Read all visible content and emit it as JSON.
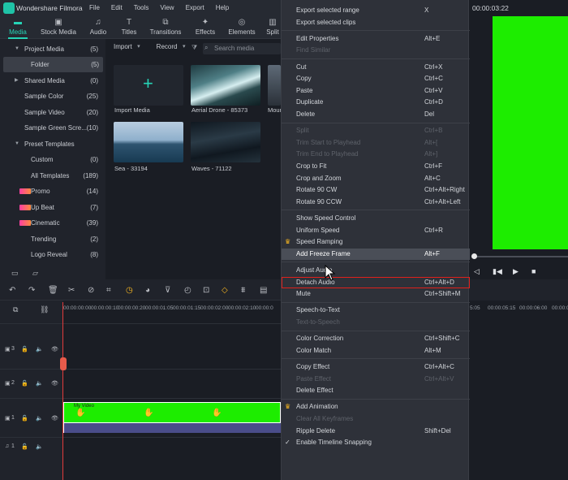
{
  "app": {
    "title": "Wondershare Filmora",
    "menu": [
      "File",
      "Edit",
      "Tools",
      "View",
      "Export",
      "Help"
    ]
  },
  "tabs": [
    {
      "label": "Media",
      "active": true,
      "icon": "folder-icon"
    },
    {
      "label": "Stock Media",
      "active": false,
      "icon": "stock-icon"
    },
    {
      "label": "Audio",
      "active": false,
      "icon": "music-icon"
    },
    {
      "label": "Titles",
      "active": false,
      "icon": "text-icon"
    },
    {
      "label": "Transitions",
      "active": false,
      "icon": "transition-icon"
    },
    {
      "label": "Effects",
      "active": false,
      "icon": "effects-icon"
    },
    {
      "label": "Elements",
      "active": false,
      "icon": "elements-icon"
    },
    {
      "label": "Split",
      "active": false,
      "icon": "split-icon"
    }
  ],
  "sidebar": [
    {
      "label": "Project Media",
      "count": "(5)",
      "expanded": true
    },
    {
      "label": "Folder",
      "count": "(5)",
      "selected": true
    },
    {
      "label": "Shared Media",
      "count": "(0)"
    },
    {
      "label": "Sample Color",
      "count": "(25)"
    },
    {
      "label": "Sample Video",
      "count": "(20)"
    },
    {
      "label": "Sample Green Scre...",
      "count": "(10)"
    },
    {
      "label": "Preset Templates",
      "count": ""
    },
    {
      "label": "Custom",
      "count": "(0)"
    },
    {
      "label": "All Templates",
      "count": "(189)"
    },
    {
      "label": "Promo",
      "count": "(14)",
      "badge": "NEW"
    },
    {
      "label": "Up Beat",
      "count": "(7)",
      "badge": "NEW"
    },
    {
      "label": "Cinematic",
      "count": "(39)",
      "badge": "NEW"
    },
    {
      "label": "Trending",
      "count": "(2)"
    },
    {
      "label": "Logo Reveal",
      "count": "(8)"
    }
  ],
  "media_toolbar": {
    "import": "Import",
    "record": "Record",
    "search_placeholder": "Search media"
  },
  "media_items": [
    {
      "caption": "Import Media"
    },
    {
      "caption": "Aerial Drone - 85373"
    },
    {
      "caption": "Mour"
    },
    {
      "caption": "Sea - 33194"
    },
    {
      "caption": "Waves - 71122"
    }
  ],
  "context_menu": [
    {
      "label": "Export selected range",
      "shortcut": "X"
    },
    {
      "label": "Export selected clips",
      "shortcut": ""
    },
    {
      "sep": true
    },
    {
      "label": "Edit Properties",
      "shortcut": "Alt+E"
    },
    {
      "label": "Find Similar",
      "shortcut": "",
      "disabled": true
    },
    {
      "sep": true
    },
    {
      "label": "Cut",
      "shortcut": "Ctrl+X"
    },
    {
      "label": "Copy",
      "shortcut": "Ctrl+C"
    },
    {
      "label": "Paste",
      "shortcut": "Ctrl+V"
    },
    {
      "label": "Duplicate",
      "shortcut": "Ctrl+D"
    },
    {
      "label": "Delete",
      "shortcut": "Del"
    },
    {
      "sep": true
    },
    {
      "label": "Split",
      "shortcut": "Ctrl+B",
      "disabled": true
    },
    {
      "label": "Trim Start to Playhead",
      "shortcut": "Alt+[",
      "disabled": true
    },
    {
      "label": "Trim End to Playhead",
      "shortcut": "Alt+]",
      "disabled": true
    },
    {
      "label": "Crop to Fit",
      "shortcut": "Ctrl+F"
    },
    {
      "label": "Crop and Zoom",
      "shortcut": "Alt+C"
    },
    {
      "label": "Rotate 90 CW",
      "shortcut": "Ctrl+Alt+Right"
    },
    {
      "label": "Rotate 90 CCW",
      "shortcut": "Ctrl+Alt+Left"
    },
    {
      "sep": true
    },
    {
      "label": "Show Speed Control",
      "shortcut": ""
    },
    {
      "label": "Uniform Speed",
      "shortcut": "Ctrl+R"
    },
    {
      "label": "Speed Ramping",
      "shortcut": "",
      "crown": true
    },
    {
      "label": "Add Freeze Frame",
      "shortcut": "Alt+F",
      "highlight": true
    },
    {
      "sep": true
    },
    {
      "label": "Adjust Audio",
      "shortcut": ""
    },
    {
      "label": "Detach Audio",
      "shortcut": "Ctrl+Alt+D",
      "boxed": true
    },
    {
      "label": "Mute",
      "shortcut": "Ctrl+Shift+M"
    },
    {
      "sep": true
    },
    {
      "label": "Speech-to-Text",
      "shortcut": ""
    },
    {
      "label": "Text-to-Speech",
      "shortcut": "",
      "disabled": true
    },
    {
      "sep": true
    },
    {
      "label": "Color Correction",
      "shortcut": "Ctrl+Shift+C"
    },
    {
      "label": "Color Match",
      "shortcut": "Alt+M"
    },
    {
      "sep": true
    },
    {
      "label": "Copy Effect",
      "shortcut": "Ctrl+Alt+C"
    },
    {
      "label": "Paste Effect",
      "shortcut": "Ctrl+Alt+V",
      "disabled": true
    },
    {
      "label": "Delete Effect",
      "shortcut": ""
    },
    {
      "sep": true
    },
    {
      "label": "Add Animation",
      "shortcut": "",
      "crown": true
    },
    {
      "label": "Clear All Keyframes",
      "shortcut": "",
      "disabled": true
    },
    {
      "label": "Ripple Delete",
      "shortcut": "Shift+Del"
    },
    {
      "label": "Enable Timeline Snapping",
      "shortcut": "",
      "check": true
    }
  ],
  "preview": {
    "timecode": "00:00:03:22",
    "screen_color": "#1ded00"
  },
  "timeline": {
    "ruler": [
      "00:00:00:00",
      "00:00:00:10",
      "00:00:00:20",
      "00:00:01:05",
      "00:00:01:15",
      "00:00:02:00",
      "00:00:02:10",
      "00:00:0"
    ],
    "ruler_right": [
      "5:05",
      "00:00:05:15",
      "00:00:06:00",
      "00:00:0"
    ],
    "tracks": [
      {
        "label": "3"
      },
      {
        "label": "2"
      },
      {
        "label": "1"
      },
      {
        "label": "1"
      }
    ],
    "clip_name": "My Video"
  },
  "colors": {
    "accent": "#26d4b6",
    "green_screen": "#1ded00",
    "highlight_box": "#e0201c",
    "playhead": "#e23b3b"
  }
}
